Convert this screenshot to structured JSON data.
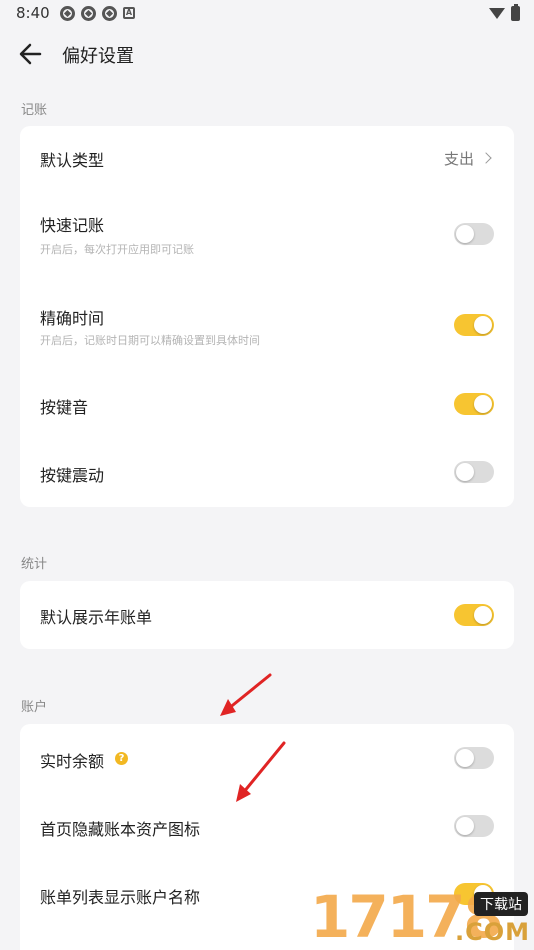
{
  "status_bar": {
    "time": "8:40"
  },
  "header": {
    "title": "偏好设置"
  },
  "sections": {
    "bookkeeping": {
      "label": "记账",
      "default_type": {
        "title": "默认类型",
        "value": "支出"
      },
      "quick_record": {
        "title": "快速记账",
        "subtitle": "开启后，每次打开应用即可记账",
        "on": false
      },
      "precise_time": {
        "title": "精确时间",
        "subtitle": "开启后，记账时日期可以精确设置到具体时间",
        "on": true
      },
      "key_sound": {
        "title": "按键音",
        "on": true
      },
      "key_vibration": {
        "title": "按键震动",
        "on": false
      }
    },
    "statistics": {
      "label": "统计",
      "default_year_bill": {
        "title": "默认展示年账单",
        "on": true
      }
    },
    "account": {
      "label": "账户",
      "realtime_balance": {
        "title": "实时余额",
        "help": "?",
        "on": false
      },
      "hide_asset_icon": {
        "title": "首页隐藏账本资产图标",
        "on": false
      },
      "show_account_name": {
        "title": "账单列表显示账户名称",
        "on": true
      }
    }
  },
  "watermark": {
    "digits": "17178",
    "badge": "下载站",
    "suffix": ".COM"
  },
  "colors": {
    "accent": "#f7c531",
    "toggle_off": "#dcdcdc",
    "annotation_arrow": "#e02424"
  }
}
